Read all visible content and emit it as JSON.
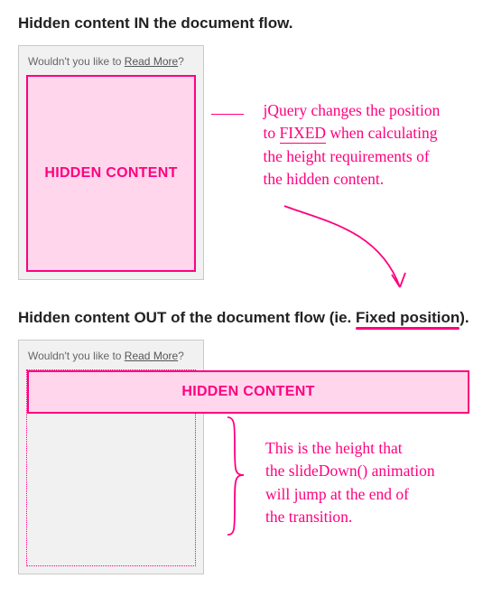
{
  "section1": {
    "titlePrefix": "Hidden content ",
    "titleEm": "IN",
    "titleSuffix": " the document flow."
  },
  "doc": {
    "promptPrefix": "Wouldn't you like to ",
    "readMore": "Read More",
    "promptSuffix": "?",
    "hiddenLabel": "HIDDEN CONTENT"
  },
  "annotation1": {
    "l1a": "jQuery changes the position",
    "l2a": "to ",
    "fixed": "FIXED",
    "l2b": " when calculating",
    "l3": "the height requirements of",
    "l4": "the hidden content."
  },
  "section2": {
    "titlePrefix": "Hidden content ",
    "titleEm": "OUT",
    "titleMid": " of the document flow (ie. ",
    "underlined": "Fixed position",
    "titleSuffix": ")."
  },
  "annotation2": {
    "l1": "This is the height that",
    "l2": "the slideDown() animation",
    "l3a": "will ",
    "jump": "jump",
    "l3b": " at the end of",
    "l4": "the transition."
  }
}
